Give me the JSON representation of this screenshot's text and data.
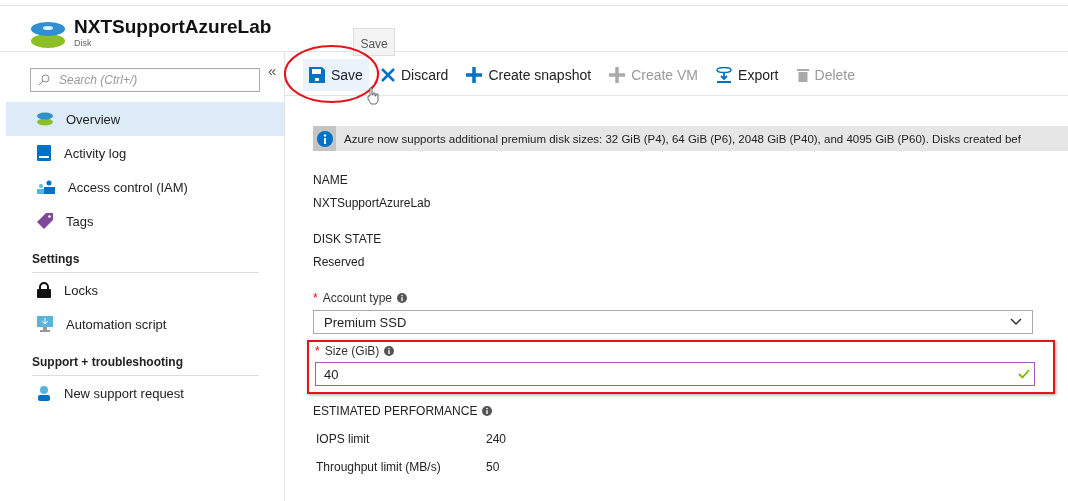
{
  "header": {
    "title": "NXTSupportAzureLab",
    "subtitle": "Disk",
    "tooltip": "Save"
  },
  "sidebar": {
    "search": {
      "placeholder": "Search (Ctrl+/)"
    },
    "collapse": "«",
    "sections": [
      {
        "items": [
          {
            "label": "Overview",
            "kind": "disk",
            "selected": true
          },
          {
            "label": "Activity log",
            "kind": "log",
            "selected": false
          },
          {
            "label": "Access control (IAM)",
            "kind": "people",
            "selected": false
          },
          {
            "label": "Tags",
            "kind": "tag",
            "selected": false
          }
        ]
      },
      {
        "heading": "Settings",
        "items": [
          {
            "label": "Locks",
            "kind": "lock",
            "selected": false
          },
          {
            "label": "Automation script",
            "kind": "monitor",
            "selected": false
          }
        ]
      },
      {
        "heading": "Support + troubleshooting",
        "items": [
          {
            "label": "New support request",
            "kind": "support",
            "selected": false
          }
        ]
      }
    ]
  },
  "toolbar": [
    {
      "label": "Save",
      "kind": "save",
      "disabled": false,
      "hovered": true,
      "circled": true
    },
    {
      "label": "Discard",
      "kind": "discard",
      "disabled": false,
      "hovered": false,
      "circled": false
    },
    {
      "label": "Create snapshot",
      "kind": "add",
      "disabled": false,
      "hovered": false,
      "circled": false
    },
    {
      "label": "Create VM",
      "kind": "add",
      "disabled": true,
      "hovered": false,
      "circled": false
    },
    {
      "label": "Export",
      "kind": "export",
      "disabled": false,
      "hovered": false,
      "circled": false
    },
    {
      "label": "Delete",
      "kind": "delete",
      "disabled": true,
      "hovered": false,
      "circled": false
    }
  ],
  "banner": "Azure now supports additional premium disk sizes: 32 GiB (P4), 64 GiB (P6), 2048 GiB (P40), and 4095 GiB (P60). Disks created bef",
  "properties": [
    {
      "label": "NAME",
      "value": "NXTSupportAzureLab"
    },
    {
      "label": "DISK STATE",
      "value": "Reserved"
    }
  ],
  "account_type": {
    "required_mark": "*",
    "label": "Account type",
    "value": "Premium SSD"
  },
  "size": {
    "required_mark": "*",
    "label": "Size (GiB)",
    "value": "40",
    "valid": true,
    "outlined": true
  },
  "performance": {
    "heading": "ESTIMATED PERFORMANCE",
    "rows": [
      {
        "label": "IOPS limit",
        "value": "240"
      },
      {
        "label": "Throughput limit (MB/s)",
        "value": "50"
      }
    ]
  }
}
